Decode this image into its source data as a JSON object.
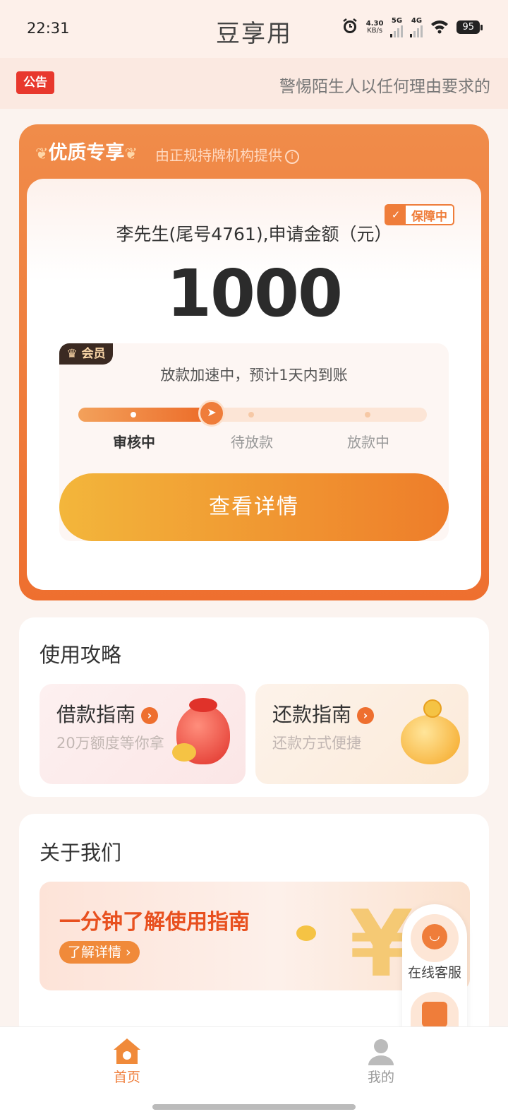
{
  "status_bar": {
    "time": "22:31",
    "speed": "4.30",
    "speed_unit": "KB/s",
    "net1": "5G",
    "net2": "4G",
    "battery": "95"
  },
  "app": {
    "title": "豆享用"
  },
  "notice": {
    "badge": "公告",
    "text": "警惕陌生人以任何理由要求的"
  },
  "premium": {
    "badge": "优质专享",
    "subtitle": "由正规持牌机构提供",
    "guard_label": "保障中",
    "applicant": "李先生(尾号4761),申请金额（元）",
    "amount": "1000",
    "member_label": "会员",
    "progress_text": "放款加速中，预计1天内到账",
    "progress_fraction": 0.38,
    "steps": [
      "审核中",
      "待放款",
      "放款中"
    ],
    "active_step": 0,
    "detail_button": "查看详情"
  },
  "guide": {
    "title": "使用攻略",
    "tiles": [
      {
        "title": "借款指南",
        "subtitle": "20万额度等你拿",
        "image": "money-bag-icon"
      },
      {
        "title": "还款指南",
        "subtitle": "还款方式便捷",
        "image": "piggy-bank-icon"
      }
    ]
  },
  "about": {
    "title": "关于我们",
    "banner_title": "一分钟了解使用指南",
    "banner_button": "了解详情",
    "banner_symbol": "¥"
  },
  "float_service": {
    "label": "在线客服"
  },
  "tabbar": {
    "items": [
      {
        "label": "首页",
        "icon": "home-icon",
        "active": true
      },
      {
        "label": "我的",
        "icon": "user-icon",
        "active": false
      }
    ]
  },
  "colors": {
    "accent": "#ee6f2f",
    "button_start": "#f3b63b",
    "button_end": "#ee7d2a",
    "notice_red": "#e8382d"
  }
}
